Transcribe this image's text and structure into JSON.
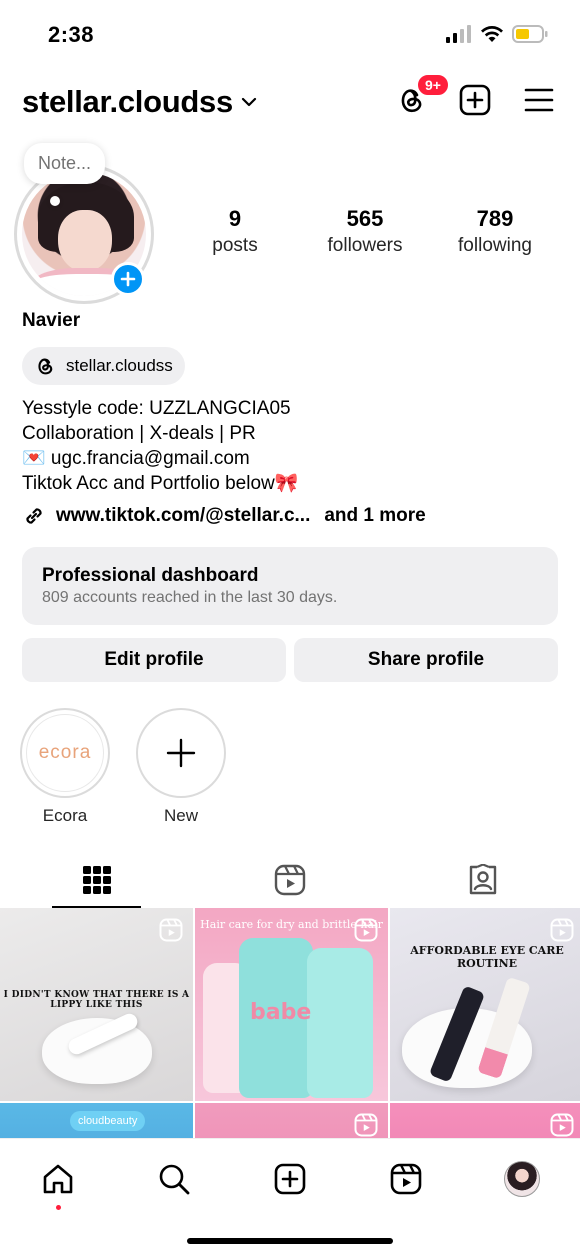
{
  "status_bar": {
    "time": "2:38"
  },
  "header": {
    "username": "stellar.cloudss",
    "threads_badge": "9+"
  },
  "profile": {
    "note_placeholder": "Note...",
    "display_name": "Navier",
    "threads_handle": "stellar.cloudss",
    "stats": [
      {
        "value": "9",
        "label": "posts"
      },
      {
        "value": "565",
        "label": "followers"
      },
      {
        "value": "789",
        "label": "following"
      }
    ],
    "bio_lines": [
      "Yesstyle code: UZZLANGCIA05",
      "Collaboration | X-deals | PR",
      "💌 ugc.francia@gmail.com",
      "Tiktok Acc and Portfolio below🎀"
    ],
    "link_text": "www.tiktok.com/@stellar.c...",
    "link_more": "and 1 more"
  },
  "professional_dashboard": {
    "title": "Professional dashboard",
    "subtitle": "809 accounts reached in the last 30 days."
  },
  "buttons": {
    "edit": "Edit profile",
    "share": "Share profile"
  },
  "highlights": [
    {
      "label": "Ecora",
      "cover_text": "ecora"
    },
    {
      "label": "New"
    }
  ],
  "grid": {
    "post1_caption": "I DIDN'T KNOW THAT THERE IS A LIPPY LIKE THIS",
    "post2_caption": "Hair care for dry and brittle hair",
    "post2_brand": "babe",
    "post3_caption": "AFFORDABLE EYE CARE ROUTINE",
    "post4_caption": "cloudbeauty"
  },
  "colors": {
    "accent_blue": "#0095f6",
    "badge_red": "#ff1e3c",
    "button_gray": "#efeff1",
    "secondary_text": "#737373"
  }
}
